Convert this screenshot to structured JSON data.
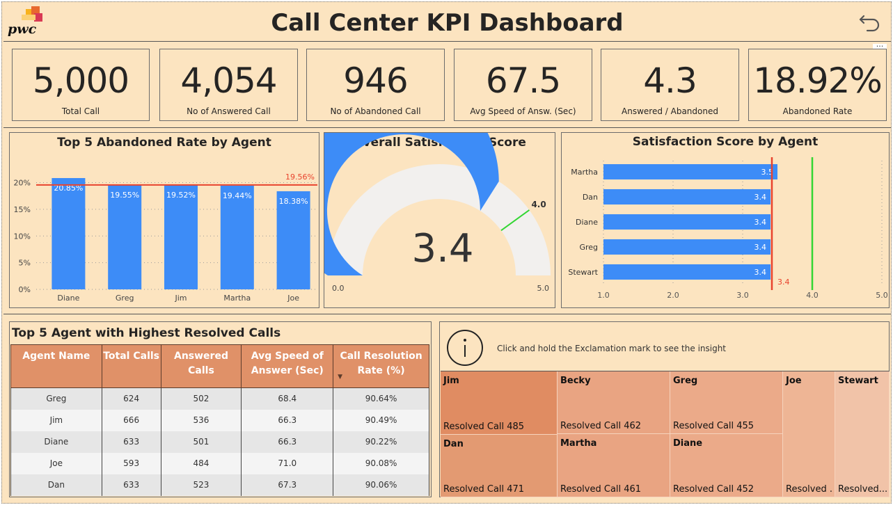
{
  "header": {
    "title": "Call Center KPI Dashboard",
    "logo_text": "pwc"
  },
  "kpis": [
    {
      "value": "5,000",
      "label": "Total Call"
    },
    {
      "value": "4,054",
      "label": "No of Answered Call"
    },
    {
      "value": "946",
      "label": "No of Abandoned Call"
    },
    {
      "value": "67.5",
      "label": "Avg Speed of Answ. (Sec)"
    },
    {
      "value": "4.3",
      "label": "Answered / Abandoned"
    },
    {
      "value": "18.92%",
      "label": "Abandoned Rate"
    }
  ],
  "colors": {
    "background": "#fce4c0",
    "bar": "#3d8cf7",
    "ref_line": "#e8432d",
    "target": "#33d633",
    "table_header": "#e09168"
  },
  "chart_data": [
    {
      "type": "bar",
      "title": "Top 5 Abandoned Rate by Agent",
      "categories": [
        "Diane",
        "Greg",
        "Jim",
        "Martha",
        "Joe"
      ],
      "values": [
        20.85,
        19.55,
        19.52,
        19.44,
        18.38
      ],
      "value_labels": [
        "20.85%",
        "19.55%",
        "19.52%",
        "19.44%",
        "18.38%"
      ],
      "ylim": [
        0,
        21.5
      ],
      "yticks": [
        0,
        5,
        10,
        15,
        20
      ],
      "ytick_labels": [
        "0%",
        "5%",
        "10%",
        "15%",
        "20%"
      ],
      "reference_line": {
        "value": 19.56,
        "label": "19.56%"
      }
    },
    {
      "type": "gauge",
      "title": "Overall Satisfaction Score",
      "value": 3.4,
      "value_label": "3.4",
      "min": 0,
      "max": 5,
      "min_label": "0.0",
      "max_label": "5.0",
      "target": 4.0,
      "target_label": "4.0"
    },
    {
      "type": "bar",
      "orientation": "horizontal",
      "title": "Satisfaction Score by Agent",
      "categories": [
        "Martha",
        "Dan",
        "Diane",
        "Greg",
        "Stewart"
      ],
      "values": [
        3.5,
        3.4,
        3.4,
        3.4,
        3.4
      ],
      "value_labels": [
        "3.5",
        "3.4",
        "3.4",
        "3.4",
        "3.4"
      ],
      "xlim": [
        1.0,
        5.0
      ],
      "xticks": [
        1.0,
        2.0,
        3.0,
        4.0,
        5.0
      ],
      "xtick_labels": [
        "1.0",
        "2.0",
        "3.0",
        "4.0",
        "5.0"
      ],
      "reference_line": {
        "value": 3.42,
        "label": "3.4"
      },
      "target_line": {
        "value": 4.0
      }
    }
  ],
  "table": {
    "title": "Top 5 Agent with Highest Resolved Calls",
    "columns": [
      "Agent Name",
      "Total Calls",
      "Answered Calls",
      "Avg Speed of Answer (Sec)",
      "Call Resolution Rate (%)"
    ],
    "rows": [
      [
        "Greg",
        "624",
        "502",
        "68.4",
        "90.64%"
      ],
      [
        "Jim",
        "666",
        "536",
        "66.3",
        "90.49%"
      ],
      [
        "Diane",
        "633",
        "501",
        "66.3",
        "90.22%"
      ],
      [
        "Joe",
        "593",
        "484",
        "71.0",
        "90.08%"
      ],
      [
        "Dan",
        "633",
        "523",
        "67.3",
        "90.06%"
      ]
    ]
  },
  "insight": {
    "text": "Click and hold the Exclamation mark to see the insight",
    "icon": "info-icon"
  },
  "treemap": [
    {
      "name": "Jim",
      "label": "Resolved Call 485",
      "color": "#e08c62"
    },
    {
      "name": "Dan",
      "label": "Resolved Call 471",
      "color": "#e39a72"
    },
    {
      "name": "Becky",
      "label": "Resolved Call 462",
      "color": "#e9a482"
    },
    {
      "name": "Martha",
      "label": "Resolved Call 461",
      "color": "#e9a482"
    },
    {
      "name": "Greg",
      "label": "Resolved Call 455",
      "color": "#ebaa89"
    },
    {
      "name": "Diane",
      "label": "Resolved Call 452",
      "color": "#ebaa89"
    },
    {
      "name": "Joe",
      "label": "Resolved ...",
      "color": "#eeb595"
    },
    {
      "name": "Stewart",
      "label": "Resolved...",
      "color": "#f1c3a8"
    }
  ]
}
